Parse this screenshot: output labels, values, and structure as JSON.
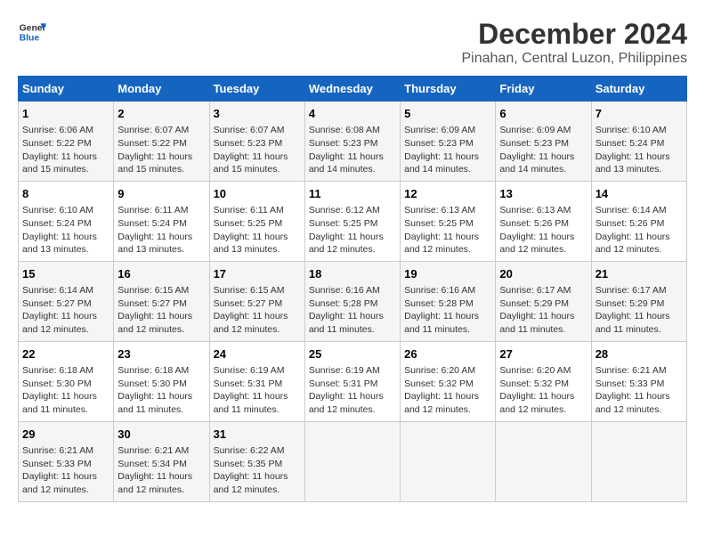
{
  "logo": {
    "line1": "General",
    "line2": "Blue"
  },
  "title": "December 2024",
  "subtitle": "Pinahan, Central Luzon, Philippines",
  "headers": [
    "Sunday",
    "Monday",
    "Tuesday",
    "Wednesday",
    "Thursday",
    "Friday",
    "Saturday"
  ],
  "weeks": [
    [
      {
        "day": "1",
        "info": "Sunrise: 6:06 AM\nSunset: 5:22 PM\nDaylight: 11 hours and 15 minutes."
      },
      {
        "day": "2",
        "info": "Sunrise: 6:07 AM\nSunset: 5:22 PM\nDaylight: 11 hours and 15 minutes."
      },
      {
        "day": "3",
        "info": "Sunrise: 6:07 AM\nSunset: 5:23 PM\nDaylight: 11 hours and 15 minutes."
      },
      {
        "day": "4",
        "info": "Sunrise: 6:08 AM\nSunset: 5:23 PM\nDaylight: 11 hours and 14 minutes."
      },
      {
        "day": "5",
        "info": "Sunrise: 6:09 AM\nSunset: 5:23 PM\nDaylight: 11 hours and 14 minutes."
      },
      {
        "day": "6",
        "info": "Sunrise: 6:09 AM\nSunset: 5:23 PM\nDaylight: 11 hours and 14 minutes."
      },
      {
        "day": "7",
        "info": "Sunrise: 6:10 AM\nSunset: 5:24 PM\nDaylight: 11 hours and 13 minutes."
      }
    ],
    [
      {
        "day": "8",
        "info": "Sunrise: 6:10 AM\nSunset: 5:24 PM\nDaylight: 11 hours and 13 minutes."
      },
      {
        "day": "9",
        "info": "Sunrise: 6:11 AM\nSunset: 5:24 PM\nDaylight: 11 hours and 13 minutes."
      },
      {
        "day": "10",
        "info": "Sunrise: 6:11 AM\nSunset: 5:25 PM\nDaylight: 11 hours and 13 minutes."
      },
      {
        "day": "11",
        "info": "Sunrise: 6:12 AM\nSunset: 5:25 PM\nDaylight: 11 hours and 12 minutes."
      },
      {
        "day": "12",
        "info": "Sunrise: 6:13 AM\nSunset: 5:25 PM\nDaylight: 11 hours and 12 minutes."
      },
      {
        "day": "13",
        "info": "Sunrise: 6:13 AM\nSunset: 5:26 PM\nDaylight: 11 hours and 12 minutes."
      },
      {
        "day": "14",
        "info": "Sunrise: 6:14 AM\nSunset: 5:26 PM\nDaylight: 11 hours and 12 minutes."
      }
    ],
    [
      {
        "day": "15",
        "info": "Sunrise: 6:14 AM\nSunset: 5:27 PM\nDaylight: 11 hours and 12 minutes."
      },
      {
        "day": "16",
        "info": "Sunrise: 6:15 AM\nSunset: 5:27 PM\nDaylight: 11 hours and 12 minutes."
      },
      {
        "day": "17",
        "info": "Sunrise: 6:15 AM\nSunset: 5:27 PM\nDaylight: 11 hours and 12 minutes."
      },
      {
        "day": "18",
        "info": "Sunrise: 6:16 AM\nSunset: 5:28 PM\nDaylight: 11 hours and 11 minutes."
      },
      {
        "day": "19",
        "info": "Sunrise: 6:16 AM\nSunset: 5:28 PM\nDaylight: 11 hours and 11 minutes."
      },
      {
        "day": "20",
        "info": "Sunrise: 6:17 AM\nSunset: 5:29 PM\nDaylight: 11 hours and 11 minutes."
      },
      {
        "day": "21",
        "info": "Sunrise: 6:17 AM\nSunset: 5:29 PM\nDaylight: 11 hours and 11 minutes."
      }
    ],
    [
      {
        "day": "22",
        "info": "Sunrise: 6:18 AM\nSunset: 5:30 PM\nDaylight: 11 hours and 11 minutes."
      },
      {
        "day": "23",
        "info": "Sunrise: 6:18 AM\nSunset: 5:30 PM\nDaylight: 11 hours and 11 minutes."
      },
      {
        "day": "24",
        "info": "Sunrise: 6:19 AM\nSunset: 5:31 PM\nDaylight: 11 hours and 11 minutes."
      },
      {
        "day": "25",
        "info": "Sunrise: 6:19 AM\nSunset: 5:31 PM\nDaylight: 11 hours and 12 minutes."
      },
      {
        "day": "26",
        "info": "Sunrise: 6:20 AM\nSunset: 5:32 PM\nDaylight: 11 hours and 12 minutes."
      },
      {
        "day": "27",
        "info": "Sunrise: 6:20 AM\nSunset: 5:32 PM\nDaylight: 11 hours and 12 minutes."
      },
      {
        "day": "28",
        "info": "Sunrise: 6:21 AM\nSunset: 5:33 PM\nDaylight: 11 hours and 12 minutes."
      }
    ],
    [
      {
        "day": "29",
        "info": "Sunrise: 6:21 AM\nSunset: 5:33 PM\nDaylight: 11 hours and 12 minutes."
      },
      {
        "day": "30",
        "info": "Sunrise: 6:21 AM\nSunset: 5:34 PM\nDaylight: 11 hours and 12 minutes."
      },
      {
        "day": "31",
        "info": "Sunrise: 6:22 AM\nSunset: 5:35 PM\nDaylight: 11 hours and 12 minutes."
      },
      {
        "day": "",
        "info": ""
      },
      {
        "day": "",
        "info": ""
      },
      {
        "day": "",
        "info": ""
      },
      {
        "day": "",
        "info": ""
      }
    ]
  ]
}
